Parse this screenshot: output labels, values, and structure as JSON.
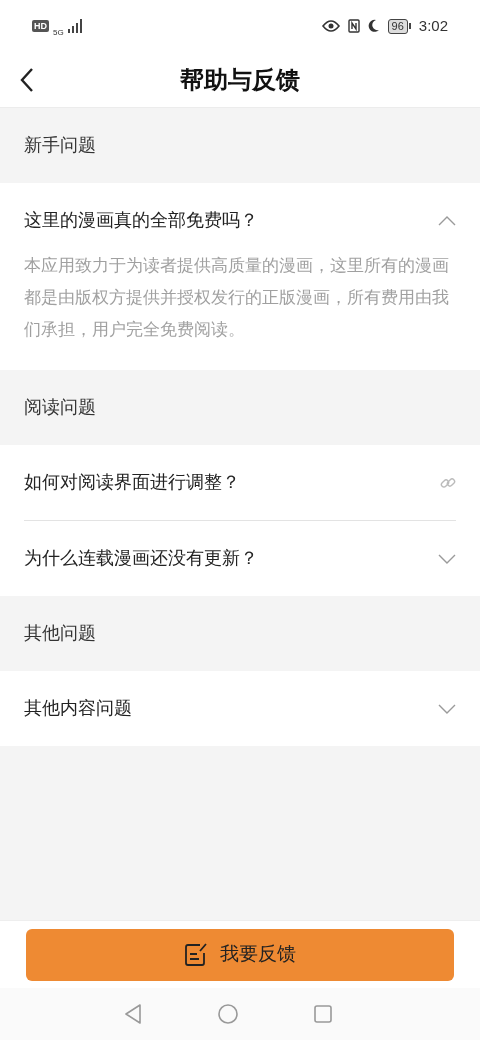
{
  "status_bar": {
    "network_badge": "HD",
    "network_type": "5G",
    "battery": "96",
    "time": "3:02"
  },
  "header": {
    "title": "帮助与反馈"
  },
  "sections": [
    {
      "title": "新手问题",
      "items": [
        {
          "kind": "accordion",
          "question": "这里的漫画真的全部免费吗？",
          "expanded": true,
          "answer": "本应用致力于为读者提供高质量的漫画，这里所有的漫画都是由版权方提供并授权发行的正版漫画，所有费用由我们承担，用户完全免费阅读。"
        }
      ]
    },
    {
      "title": "阅读问题",
      "items": [
        {
          "kind": "link",
          "question": "如何对阅读界面进行调整？"
        },
        {
          "kind": "accordion",
          "question": "为什么连载漫画还没有更新？",
          "expanded": false
        }
      ]
    },
    {
      "title": "其他问题",
      "items": [
        {
          "kind": "accordion",
          "question": "其他内容问题",
          "expanded": false
        }
      ]
    }
  ],
  "feedback_button": {
    "label": "我要反馈"
  }
}
